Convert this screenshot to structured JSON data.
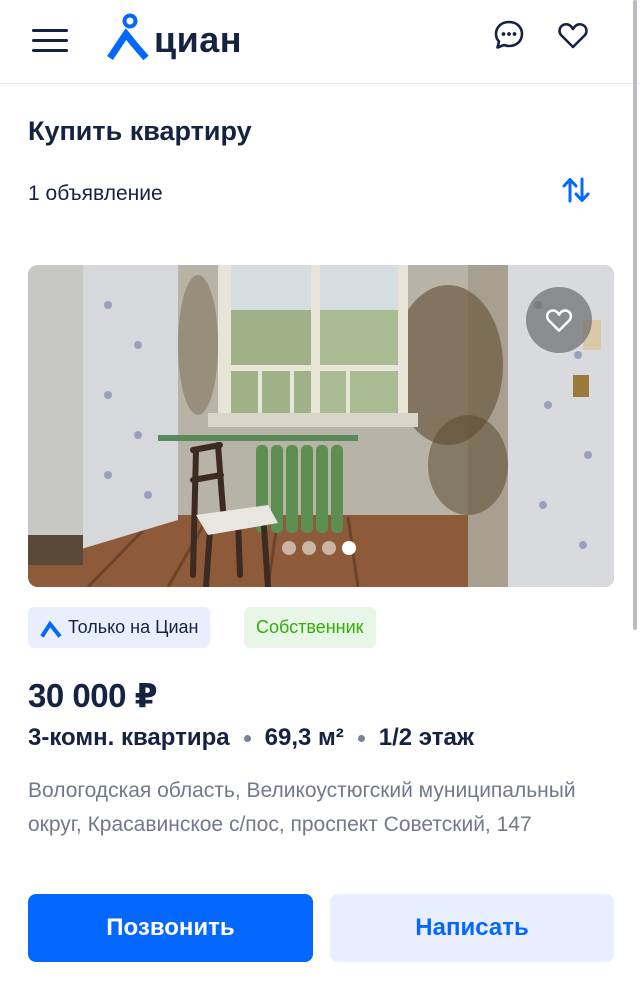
{
  "header": {
    "logo_text": "циан",
    "menu_icon": "hamburger-menu-icon",
    "chat_icon": "chat-bubble-icon",
    "favorites_icon": "heart-outline-icon"
  },
  "page": {
    "title": "Купить квартиру",
    "results_count": "1 объявление",
    "sort_icon": "sort-arrows-icon"
  },
  "listing": {
    "photo": {
      "description_icon": "apartment-photo",
      "favorite_icon": "heart-outline-icon",
      "dots_total": 4,
      "active_dot": 4
    },
    "badges": {
      "cian_only": "Только на Циан",
      "owner": "Собственник"
    },
    "price": "30 000 ₽",
    "rooms": "3-комн. квартира",
    "area": "69,3 м²",
    "floor": "1/2 этаж",
    "address": "Вологодская область, Великоустюгский муниципальный округ, Красавинское с/пос, проспект Советский, 147",
    "call_button": "Позвонить",
    "write_button": "Написать"
  },
  "colors": {
    "primary": "#0468ff",
    "text": "#152242",
    "secondary_text": "#707a8c",
    "owner_badge_text": "#34ac0a",
    "light_blue": "#e9effe"
  }
}
